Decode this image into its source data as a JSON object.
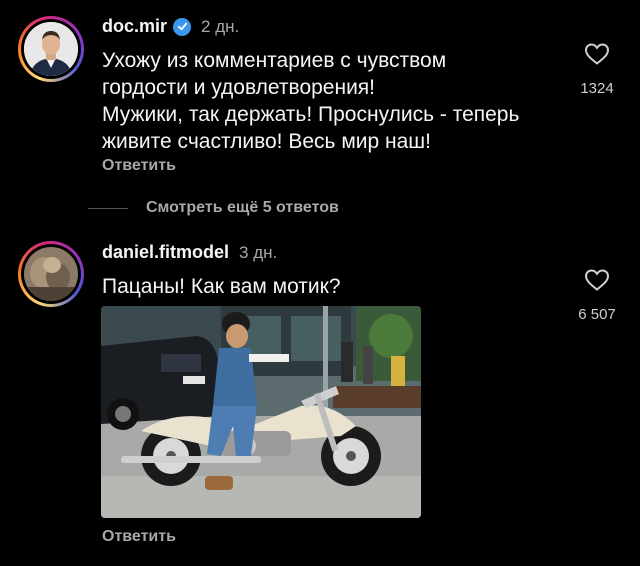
{
  "comments": [
    {
      "username": "doc.mir",
      "verified": true,
      "time": "2 дн.",
      "text_lines": [
        "Ухожу из комментариев с чувством",
        "гордости и удовлетворения!",
        "Мужики, так держать! Проснулись - теперь",
        "живите счастливо! Весь мир наш!"
      ],
      "reply_label": "Ответить",
      "likes": "1324"
    },
    {
      "username": "daniel.fitmodel",
      "verified": false,
      "time": "3 дн.",
      "text_lines": [
        "Пацаны! Как вам мотик?"
      ],
      "reply_label": "Ответить",
      "likes": "6 507",
      "image": "motorcycle-photo"
    }
  ],
  "more_replies_label": "Смотреть ещё 5 ответов",
  "colors": {
    "background": "#000000",
    "text": "#f5f5f5",
    "muted": "#a8a8a8",
    "verified": "#3897f0"
  },
  "icons": [
    "heart-icon",
    "verified-badge-icon"
  ]
}
